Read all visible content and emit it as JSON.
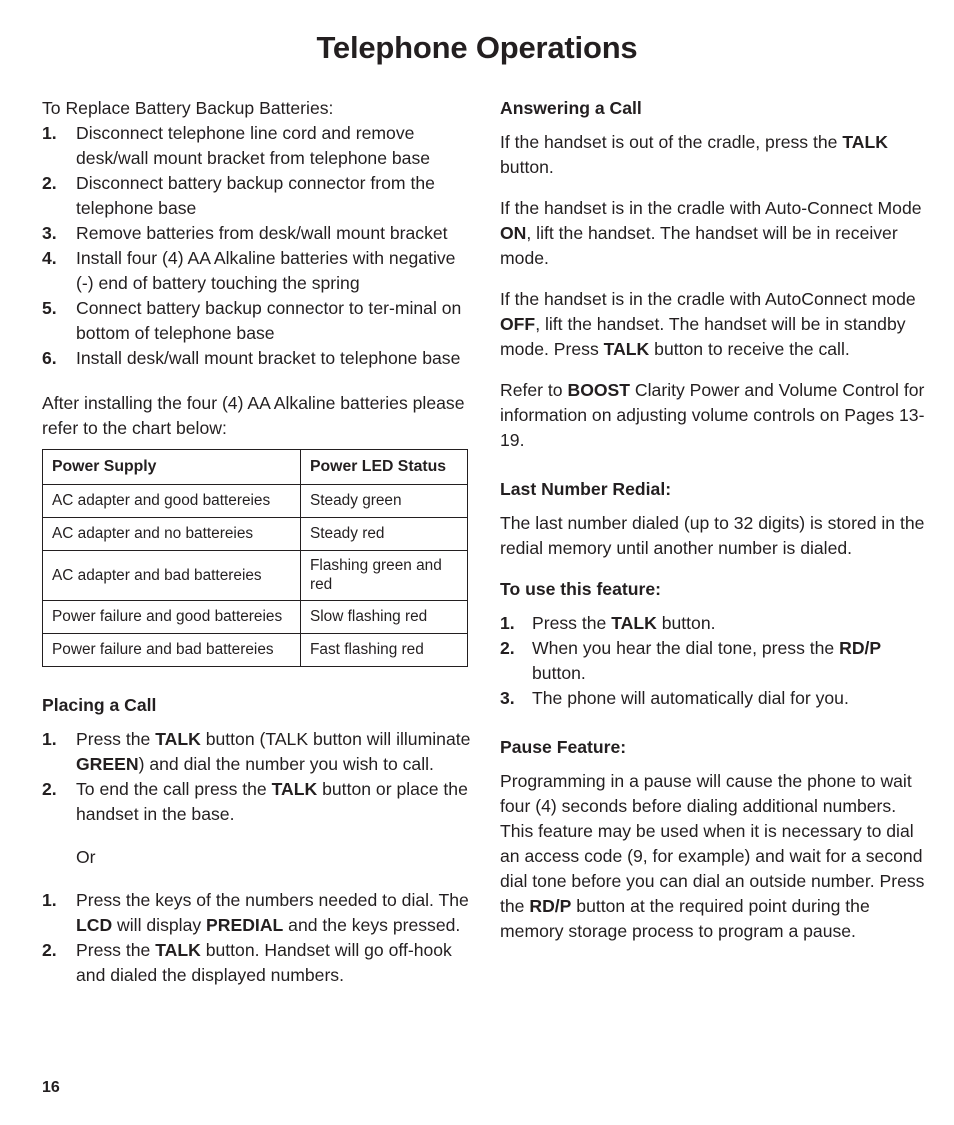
{
  "title": "Telephone Operations",
  "page_number": "16",
  "left_column": {
    "intro": "To Replace Battery Backup Batteries:",
    "replace_steps": [
      {
        "num": "1.",
        "text": "Disconnect telephone line cord and remove desk/wall mount bracket from telephone base"
      },
      {
        "num": "2.",
        "text": " Disconnect battery backup connector from the telephone base"
      },
      {
        "num": "3.",
        "text": "Remove batteries from desk/wall mount bracket"
      },
      {
        "num": "4.",
        "text": "Install four (4) AA Alkaline batteries with negative (-) end of battery touching the spring"
      },
      {
        "num": "5.",
        "text": "Connect battery backup connector to ter-minal on bottom of telephone base"
      },
      {
        "num": "6.",
        "text": "Install desk/wall mount bracket to telephone base"
      }
    ],
    "after_install": "After installing the four (4) AA Alkaline batteries please refer to the chart below:",
    "table": {
      "headers": [
        "Power Supply",
        "Power LED Status"
      ],
      "rows": [
        [
          "AC adapter and good battereies",
          "Steady green"
        ],
        [
          "AC adapter and no battereies",
          "Steady red"
        ],
        [
          "AC adapter and bad battereies",
          "Flashing green and red"
        ],
        [
          "Power failure and good battereies",
          "Slow flashing red"
        ],
        [
          "Power failure and bad battereies",
          "Fast flashing red"
        ]
      ]
    },
    "placing_a_call_heading": "Placing a Call",
    "placing_steps_1": [
      {
        "num": "1.",
        "parts": [
          {
            "t": "Press the "
          },
          {
            "t": "TALK",
            "b": true
          },
          {
            "t": " button (TALK button will illuminate "
          },
          {
            "t": "GREEN",
            "b": true
          },
          {
            "t": ") and dial the number you wish to call."
          }
        ]
      },
      {
        "num": "2.",
        "parts": [
          {
            "t": "To end the call press the "
          },
          {
            "t": "TALK",
            "b": true
          },
          {
            "t": " button or place the handset in the base."
          }
        ]
      }
    ],
    "or_label": "Or",
    "placing_steps_2": [
      {
        "num": "1.",
        "parts": [
          {
            "t": "Press the keys of the numbers needed to dial. The "
          },
          {
            "t": "LCD",
            "b": true
          },
          {
            "t": " will display "
          },
          {
            "t": "PREDIAL",
            "b": true
          },
          {
            "t": " and the keys pressed."
          }
        ]
      },
      {
        "num": "2.",
        "parts": [
          {
            "t": "Press the "
          },
          {
            "t": "TALK",
            "b": true
          },
          {
            "t": " button. Handset will go off-hook and dialed the displayed numbers."
          }
        ]
      }
    ]
  },
  "right_column": {
    "answering_heading": "Answering a Call",
    "answering_paras": [
      [
        {
          "t": "If the handset is out of the cradle, press the "
        },
        {
          "t": "TALK",
          "b": true
        },
        {
          "t": " button."
        }
      ],
      [
        {
          "t": "If the handset is in the cradle with Auto-Connect Mode "
        },
        {
          "t": "ON",
          "b": true
        },
        {
          "t": ", lift the handset. The handset will be in receiver mode."
        }
      ],
      [
        {
          "t": "If the handset is in the cradle with AutoConnect mode "
        },
        {
          "t": "OFF",
          "b": true
        },
        {
          "t": ", lift the handset. The handset will be in standby mode. Press "
        },
        {
          "t": "TALK",
          "b": true
        },
        {
          "t": " button to receive the call."
        }
      ],
      [
        {
          "t": "Refer to "
        },
        {
          "t": "BOOST",
          "b": true
        },
        {
          "t": " Clarity Power  and Volume Control for  information on adjusting volume controls on Pages 13-19."
        }
      ]
    ],
    "redial_heading": "Last Number Redial:",
    "redial_para": "The last number dialed (up to 32 digits) is stored in the redial memory until another number is dialed.",
    "use_feature_heading": "To use this feature:",
    "use_feature_steps": [
      {
        "num": "1.",
        "parts": [
          {
            "t": "Press the "
          },
          {
            "t": "TALK",
            "b": true
          },
          {
            "t": " button."
          }
        ]
      },
      {
        "num": "2.",
        "parts": [
          {
            "t": "When you hear the dial tone, press the "
          },
          {
            "t": "RD/P",
            "b": true
          },
          {
            "t": " button."
          }
        ]
      },
      {
        "num": "3.",
        "parts": [
          {
            "t": "The phone will automatically dial for you."
          }
        ]
      }
    ],
    "pause_heading": "Pause Feature:",
    "pause_para": [
      {
        "t": "Programming in a pause will cause the phone to wait four (4) seconds before dialing additional numbers. This feature may be used when it is necessary to dial an access code (9, for example) and wait for a second dial tone before you can dial an outside number. Press the "
      },
      {
        "t": "RD/P",
        "b": true
      },
      {
        "t": " button at the required point during the memory storage process to program a pause."
      }
    ]
  }
}
